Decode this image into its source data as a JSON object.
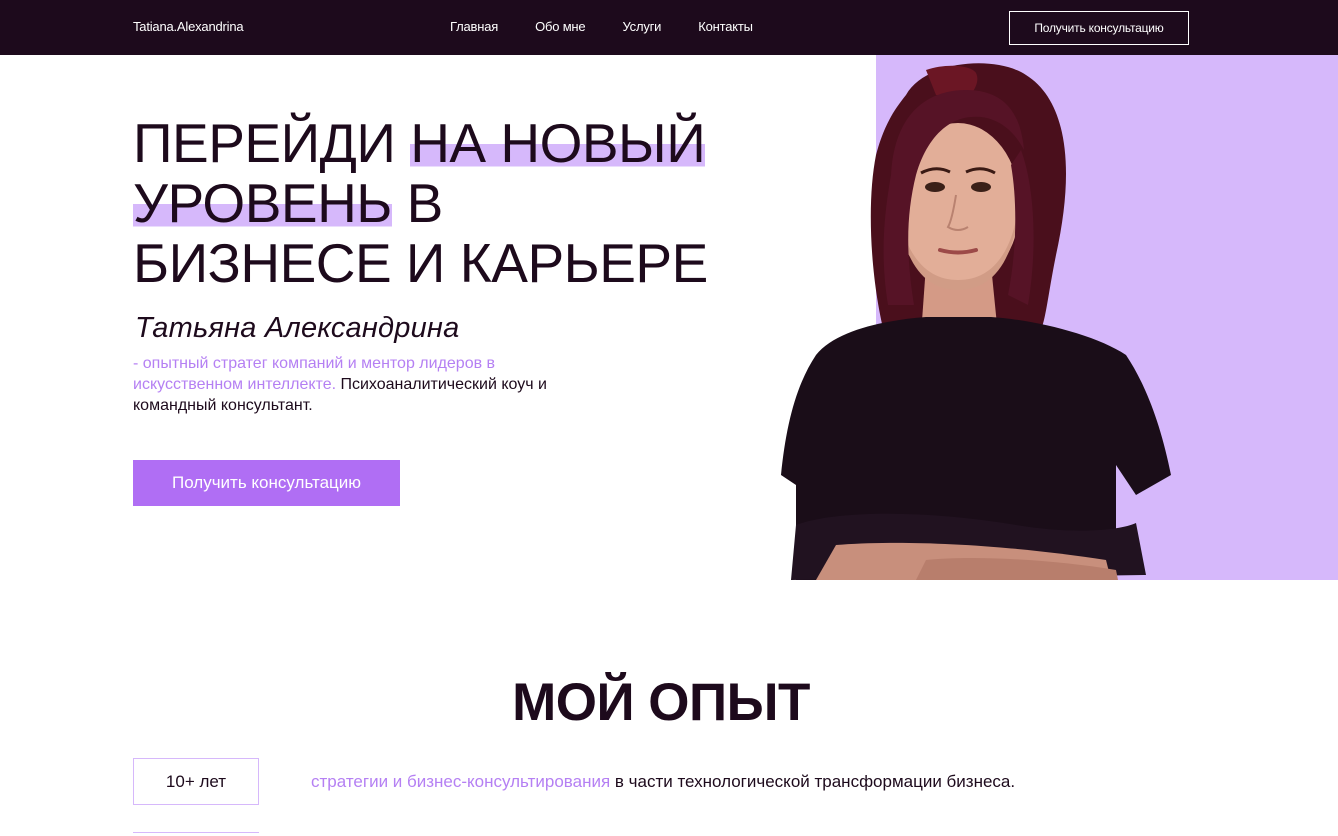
{
  "nav": {
    "logo": "Tatiana.Alexandrina",
    "menu": [
      {
        "label": "Главная"
      },
      {
        "label": "Обо мне"
      },
      {
        "label": "Услуги"
      },
      {
        "label": "Контакты"
      }
    ],
    "cta_label": "Получить консультацию"
  },
  "hero": {
    "headline": {
      "part1": "ПЕРЕЙДИ ",
      "hl1": "НА НОВЫЙ",
      "hl2": "УРОВЕНЬ",
      "part2": " В",
      "line3": "БИЗНЕСЕ И КАРЬЕРЕ"
    },
    "name": "Татьяна Александрина",
    "desc_accent": "- опытный стратег компаний и ментор лидеров в искусственном интеллекте.",
    "desc_rest": " Психоаналитический коуч и командный консультант.",
    "cta_label": "Получить консультацию"
  },
  "experience": {
    "title": "МОЙ ОПЫТ",
    "items": [
      {
        "years": "10+ лет",
        "accent": "стратегии и бизнес-консультирования",
        "rest": " в части технологической трансформации бизнеса."
      }
    ]
  },
  "colors": {
    "dark": "#1d0a1c",
    "lavender": "#d6b8fb",
    "accent": "#b580f3",
    "button": "#b06ef4"
  },
  "icons": [
    "portrait-photo"
  ]
}
